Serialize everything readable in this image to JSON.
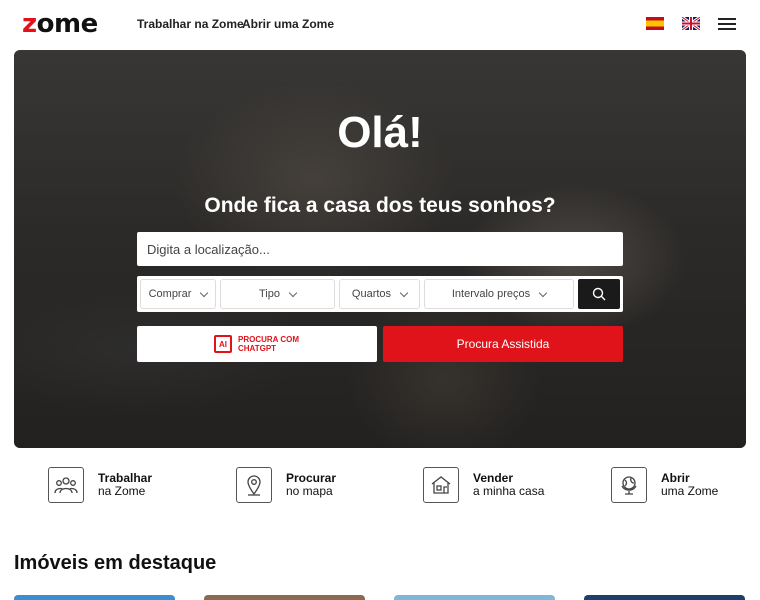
{
  "header": {
    "logo": "zome",
    "nav": [
      "Trabalhar na Zome",
      "Abrir uma Zome"
    ],
    "languages": [
      "es",
      "en"
    ]
  },
  "hero": {
    "title": "Olá!",
    "subtitle": "Onde fica a casa dos teus sonhos?",
    "location_placeholder": "Digita a localização...",
    "filters": [
      "Comprar",
      "Tipo",
      "Quartos",
      "Intervalo preços"
    ],
    "ai_badge": "AI",
    "ai_label": "PROCURA COM CHATGPT",
    "assisted_label": "Procura Assistida"
  },
  "features": [
    {
      "title": "Trabalhar",
      "subtitle": "na Zome",
      "icon": "people-icon"
    },
    {
      "title": "Procurar",
      "subtitle": "no mapa",
      "icon": "map-pin-icon"
    },
    {
      "title": "Vender",
      "subtitle": "a minha casa",
      "icon": "house-icon"
    },
    {
      "title": "Abrir",
      "subtitle": "uma Zome",
      "icon": "globe-icon"
    }
  ],
  "featured": {
    "title": "Imóveis em destaque"
  },
  "colors": {
    "brand_red": "#e0131b",
    "dark": "#1a1a1a"
  }
}
